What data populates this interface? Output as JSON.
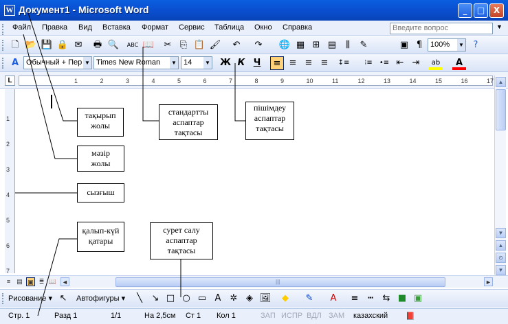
{
  "window": {
    "title": "Документ1 - Microsoft Word",
    "app_icon": "W",
    "minimize_glyph": "_",
    "maximize_glyph": "□",
    "close_glyph": "X"
  },
  "menu": {
    "items": [
      "Файл",
      "Правка",
      "Вид",
      "Вставка",
      "Формат",
      "Сервис",
      "Таблица",
      "Окно",
      "Справка"
    ],
    "help_placeholder": "Введите вопрос",
    "help_dropdown": "▼"
  },
  "standard_toolbar": {
    "icons": [
      "new-icon",
      "open-icon",
      "save-icon",
      "permission-icon",
      "email-icon",
      "print-icon",
      "print-preview-icon",
      "spelling-icon",
      "research-icon",
      "cut-icon",
      "copy-icon",
      "paste-icon",
      "format-painter-icon",
      "undo-icon",
      "redo-icon",
      "hyperlink-icon",
      "tables-borders-icon",
      "insert-table-icon",
      "insert-excel-icon",
      "columns-icon",
      "drawing-icon",
      "document-map-icon",
      "show-hide-icon"
    ],
    "glyphs": [
      "🗋",
      "📂",
      "💾",
      "🔒",
      "✉",
      "🖶",
      "🔍",
      "ABC",
      "📖",
      "✂",
      "⎘",
      "📋",
      "🖌",
      "↶",
      "↷",
      "🌐",
      "▦",
      "⊞",
      "▤",
      "⫼",
      "✎",
      "▣",
      "¶"
    ],
    "zoom": "100%",
    "help_glyph": "?"
  },
  "formatting_toolbar": {
    "style": "Обычный + Пер",
    "font": "Times New Roman",
    "size": "14",
    "bold": "Ж",
    "italic": "К",
    "underline": "Ч",
    "style_icon_glyph": "A",
    "align_glyphs": [
      "≡",
      "≡",
      "≡",
      "≡"
    ],
    "list_glyphs": [
      "⁝≡",
      "•≡",
      "⇤",
      "⇥"
    ],
    "highlight_glyph": "ab",
    "font_color_glyph": "A",
    "colors": {
      "highlight": "#ffff00",
      "font_color": "#ff0000"
    }
  },
  "ruler": {
    "corner": "L",
    "ticks": [
      "1",
      "2",
      "3",
      "4",
      "5",
      "6",
      "7",
      "8",
      "9",
      "10",
      "11",
      "12",
      "13",
      "14",
      "15",
      "16",
      "17"
    ],
    "vticks": [
      "1",
      "2",
      "3",
      "4",
      "5",
      "6",
      "7"
    ]
  },
  "scroll": {
    "up": "▲",
    "down": "▼",
    "prev": "⊙",
    "next": "▼",
    "left": "◄",
    "right": "►",
    "grip": "|||"
  },
  "view_buttons": [
    "≡",
    "▤",
    "▣",
    "≣",
    "📖"
  ],
  "drawing_toolbar": {
    "drawing": "Рисование ▾",
    "autoshapes": "Автофигуры ▾",
    "shape_glyphs": [
      "↖",
      "╲",
      "↘",
      "□",
      "○",
      "▭",
      "A",
      "✲",
      "◈",
      "🖼"
    ],
    "color_glyphs": [
      "◆",
      "✎",
      "A",
      "≡",
      "┅",
      "⇆",
      "■",
      "▣"
    ]
  },
  "status": {
    "page": "Стр. 1",
    "section": "Разд 1",
    "pages": "1/1",
    "at": "На 2,5см",
    "line": "Ст 1",
    "col": "Кол 1",
    "rec": "ЗАП",
    "trk": "ИСПР",
    "ext": "ВДЛ",
    "ovr": "ЗАМ",
    "language": "казахский",
    "spell_glyph": "📕"
  },
  "callouts": {
    "title_bar": [
      "тақырып",
      "жолы"
    ],
    "menu_bar": [
      "мәзір",
      "жолы"
    ],
    "ruler": [
      "сызғыш"
    ],
    "status_bar": [
      "қалып-күй",
      "қатары"
    ],
    "standard_toolbar": [
      "стандартты",
      "аспаптар",
      "тақтасы"
    ],
    "formatting_toolbar": [
      "пішімдеу",
      "аспаптар",
      "тақтасы"
    ],
    "drawing_toolbar": [
      "сурет салу",
      "аспаптар",
      "тақтасы"
    ]
  }
}
